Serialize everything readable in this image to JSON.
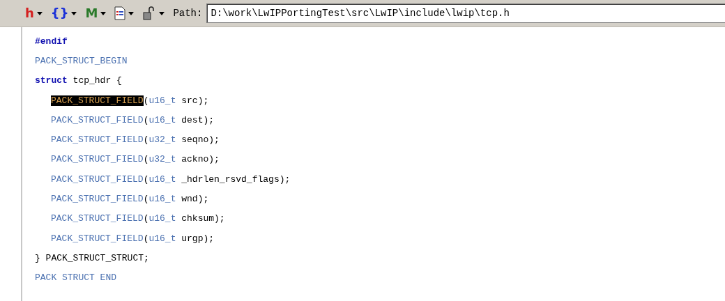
{
  "toolbar": {
    "items": [
      {
        "kind": "glyph",
        "glyph": "h",
        "color": "#d42020"
      },
      {
        "kind": "glyph",
        "glyph": "{}",
        "color": "#1a30d8"
      },
      {
        "kind": "glyph",
        "glyph": "M",
        "color": "#2a7a2a"
      },
      {
        "kind": "document"
      },
      {
        "kind": "lock"
      }
    ],
    "path_label": "Path:",
    "path_value": "D:\\work\\LwIPPortingTest\\src\\LwIP\\include\\lwip\\tcp.h"
  },
  "editor": {
    "lines": [
      {
        "indent": false,
        "tokens": [
          {
            "kind": "keyword",
            "text": "#endif"
          }
        ]
      },
      {
        "indent": false,
        "tokens": [
          {
            "kind": "macro",
            "text": "PACK_STRUCT_BEGIN"
          }
        ]
      },
      {
        "indent": false,
        "tokens": [
          {
            "kind": "keyword",
            "text": "struct"
          },
          {
            "kind": "plain",
            "text": " tcp_hdr {"
          }
        ]
      },
      {
        "indent": true,
        "tokens": [
          {
            "kind": "highlight",
            "text": "PACK_STRUCT_FIELD"
          },
          {
            "kind": "plain",
            "text": "("
          },
          {
            "kind": "type",
            "text": "u16_t"
          },
          {
            "kind": "plain",
            "text": " src);"
          }
        ]
      },
      {
        "indent": true,
        "tokens": [
          {
            "kind": "macro",
            "text": "PACK_STRUCT_FIELD"
          },
          {
            "kind": "plain",
            "text": "("
          },
          {
            "kind": "type",
            "text": "u16_t"
          },
          {
            "kind": "plain",
            "text": " dest);"
          }
        ]
      },
      {
        "indent": true,
        "tokens": [
          {
            "kind": "macro",
            "text": "PACK_STRUCT_FIELD"
          },
          {
            "kind": "plain",
            "text": "("
          },
          {
            "kind": "type",
            "text": "u32_t"
          },
          {
            "kind": "plain",
            "text": " seqno);"
          }
        ]
      },
      {
        "indent": true,
        "tokens": [
          {
            "kind": "macro",
            "text": "PACK_STRUCT_FIELD"
          },
          {
            "kind": "plain",
            "text": "("
          },
          {
            "kind": "type",
            "text": "u32_t"
          },
          {
            "kind": "plain",
            "text": " ackno);"
          }
        ]
      },
      {
        "indent": true,
        "tokens": [
          {
            "kind": "macro",
            "text": "PACK_STRUCT_FIELD"
          },
          {
            "kind": "plain",
            "text": "("
          },
          {
            "kind": "type",
            "text": "u16_t"
          },
          {
            "kind": "plain",
            "text": " _hdrlen_rsvd_flags);"
          }
        ]
      },
      {
        "indent": true,
        "tokens": [
          {
            "kind": "macro",
            "text": "PACK_STRUCT_FIELD"
          },
          {
            "kind": "plain",
            "text": "("
          },
          {
            "kind": "type",
            "text": "u16_t"
          },
          {
            "kind": "plain",
            "text": " wnd);"
          }
        ]
      },
      {
        "indent": true,
        "tokens": [
          {
            "kind": "macro",
            "text": "PACK_STRUCT_FIELD"
          },
          {
            "kind": "plain",
            "text": "("
          },
          {
            "kind": "type",
            "text": "u16_t"
          },
          {
            "kind": "plain",
            "text": " chksum);"
          }
        ]
      },
      {
        "indent": true,
        "tokens": [
          {
            "kind": "macro",
            "text": "PACK_STRUCT_FIELD"
          },
          {
            "kind": "plain",
            "text": "("
          },
          {
            "kind": "type",
            "text": "u16_t"
          },
          {
            "kind": "plain",
            "text": " urgp);"
          }
        ]
      },
      {
        "indent": false,
        "tokens": [
          {
            "kind": "plain",
            "text": "} PACK_STRUCT_STRUCT;"
          }
        ]
      },
      {
        "indent": false,
        "tokens": [
          {
            "kind": "macro",
            "text": "PACK STRUCT END"
          }
        ]
      }
    ]
  }
}
